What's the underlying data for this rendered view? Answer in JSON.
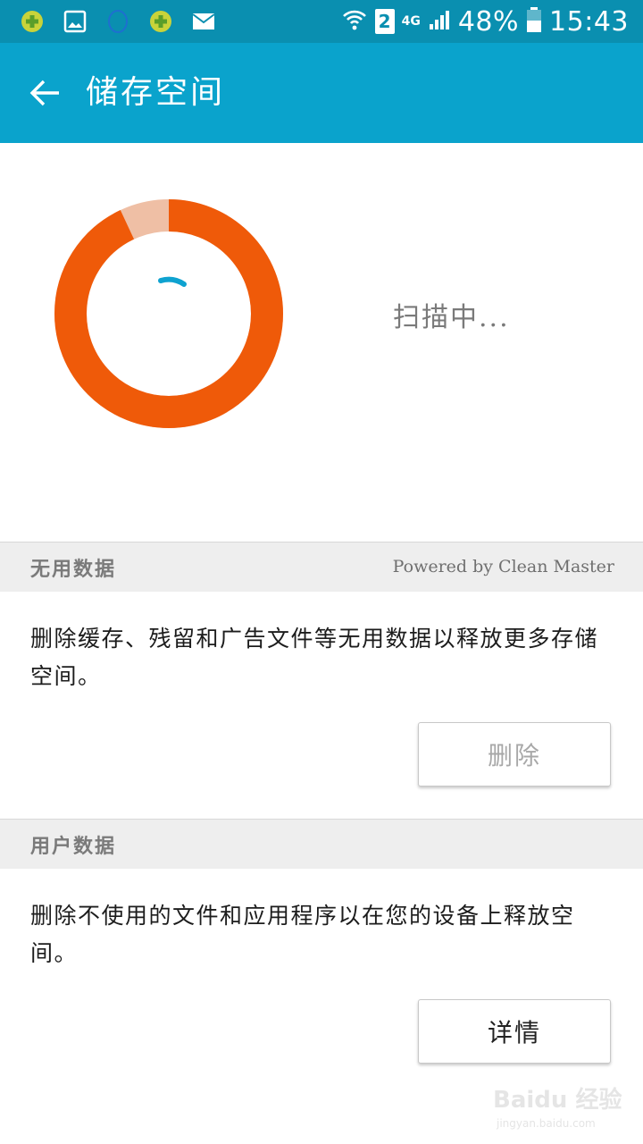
{
  "status_bar": {
    "battery": "48%",
    "time": "15:43",
    "sim_slot": "2",
    "network": "4G",
    "icons_left": [
      "360-security-icon",
      "gallery-icon",
      "circle-icon",
      "360-security-icon",
      "mail-icon"
    ],
    "icons_right": [
      "wifi-icon",
      "sim-icon",
      "signal-icon",
      "battery-icon"
    ]
  },
  "app_bar": {
    "title": "储存空间",
    "back_icon": "arrow-left-icon",
    "color": "#0aa3cc"
  },
  "storage": {
    "status": "扫描中...",
    "used_fraction": 0.93,
    "colors": {
      "used": "#ef5a09",
      "free": "#efbfa5",
      "spinner": "#0ea2d0"
    }
  },
  "junk_section": {
    "header": "无用数据",
    "powered_by": "Powered by Clean Master",
    "description": "删除缓存、残留和广告文件等无用数据以释放更多存储空间。",
    "button": "删除"
  },
  "user_section": {
    "header": "用户数据",
    "description": "删除不使用的文件和应用程序以在您的设备上释放空间。",
    "button": "详情"
  },
  "watermark": {
    "logo": "Baidu 经验",
    "url": "jingyan.baidu.com"
  }
}
